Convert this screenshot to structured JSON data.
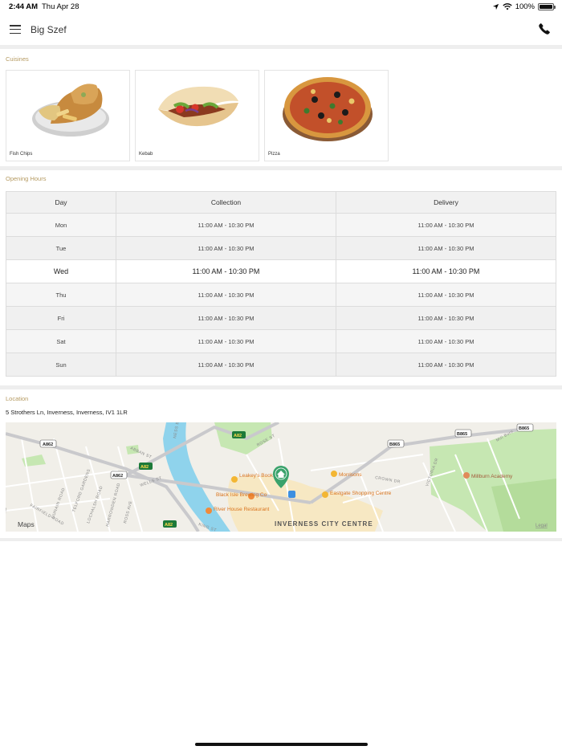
{
  "status_bar": {
    "time": "2:44 AM",
    "date": "Thu Apr 28",
    "battery": "100%",
    "icons": [
      "location-arrow-icon",
      "wifi-icon",
      "battery-icon"
    ]
  },
  "header": {
    "title": "Big Szef",
    "menu_icon": "hamburger-menu-icon",
    "phone_icon": "phone-icon"
  },
  "cuisines": {
    "label": "Cuisines",
    "items": [
      {
        "name": "Fish  Chips",
        "image": "fish-and-chips"
      },
      {
        "name": "Kebab",
        "image": "kebab"
      },
      {
        "name": "Pizza",
        "image": "pizza"
      }
    ]
  },
  "opening_hours": {
    "label": "Opening Hours",
    "columns": [
      "Day",
      "Collection",
      "Delivery"
    ],
    "rows": [
      {
        "day": "Mon",
        "collection": "11:00 AM - 10:30 PM",
        "delivery": "11:00 AM - 10:30 PM"
      },
      {
        "day": "Tue",
        "collection": "11:00 AM - 10:30 PM",
        "delivery": "11:00 AM - 10:30 PM"
      },
      {
        "day": "Wed",
        "collection": "11:00 AM - 10:30 PM",
        "delivery": "11:00 AM - 10:30 PM"
      },
      {
        "day": "Thu",
        "collection": "11:00 AM - 10:30 PM",
        "delivery": "11:00 AM - 10:30 PM"
      },
      {
        "day": "Fri",
        "collection": "11:00 AM - 10:30 PM",
        "delivery": "11:00 AM - 10:30 PM"
      },
      {
        "day": "Sat",
        "collection": "11:00 AM - 10:30 PM",
        "delivery": "11:00 AM - 10:30 PM"
      },
      {
        "day": "Sun",
        "collection": "11:00 AM - 10:30 PM",
        "delivery": "11:00 AM - 10:30 PM"
      }
    ]
  },
  "location": {
    "label": "Location",
    "address": "5 Strothers Ln, Inverness, Inverness, IV1 1LR",
    "map": {
      "attribution": "Maps",
      "legal": "Legal",
      "city_label": "INVERNESS CITY CENTRE",
      "road_labels": [
        "A862",
        "A82",
        "B865",
        "B865",
        "B865",
        "A862",
        "A82",
        "A82"
      ],
      "street_labels": [
        "ABBAN ST",
        "WELLS ST",
        "DUNAIN ROAD",
        "TELFORD GARDENS",
        "LOCHALSH ROAD",
        "HARROWDEN ROAD",
        "ROSS AVE",
        "FAIRFIELD ROAD",
        "ROSE ST",
        "CROWN DR",
        "VICTORIA DR",
        "Mill Burn",
        "KING ST",
        "NESS BANK",
        "ND"
      ],
      "pois": [
        "Leakey's Bookshop",
        "Black Isle Brewing Co",
        "River House Restaurant",
        "Morrisons",
        "Eastgate Shopping Centre",
        "Millburn Academy"
      ]
    }
  },
  "colors": {
    "label_gold": "#b59a61",
    "divider": "#eeeeee",
    "map_water": "#8fd3ec",
    "map_park": "#c6e7b2"
  }
}
